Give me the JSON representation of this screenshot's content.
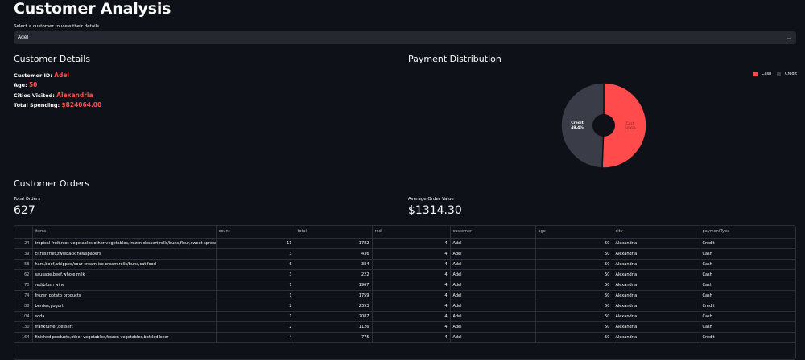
{
  "title": "Customer Analysis",
  "select": {
    "label": "Select a customer to view their details",
    "value": "Adel"
  },
  "details": {
    "heading": "Customer Details",
    "id_label": "Customer ID:",
    "id_value": "Adel",
    "age_label": "Age:",
    "age_value": "50",
    "cities_label": "Cities Visited:",
    "cities_value": "Alexandria",
    "spending_label": "Total Spending:",
    "spending_value": "$824064.00"
  },
  "payment": {
    "heading": "Payment Distribution",
    "legend": [
      "Cash",
      "Credit"
    ],
    "colors": {
      "cash": "#ff4b4b",
      "credit": "#3a3d47"
    }
  },
  "chart_data": {
    "type": "pie",
    "labels": [
      "Cash",
      "Credit"
    ],
    "values": [
      50.6,
      49.4
    ],
    "slice_labels": [
      "Cash\n50.6%",
      "Credit\n49.4%"
    ],
    "legend": "top-right"
  },
  "orders": {
    "heading": "Customer Orders",
    "total_label": "Total Orders",
    "total_value": "627",
    "avg_label": "Average Order Value",
    "avg_value": "$1314.30",
    "columns": [
      "",
      "items",
      "count",
      "total",
      "rnd",
      "customer",
      "age",
      "city",
      "paymentType"
    ],
    "rows": [
      [
        "24",
        "tropical fruit,root vegetables,other vegetables,frozen dessert,rolls/buns,flour,sweet spreads,sa",
        "11",
        "1782",
        "4",
        "Adel",
        "50",
        "Alexandria",
        "Credit"
      ],
      [
        "39",
        "citrus fruit,zwieback,newspapers",
        "3",
        "436",
        "4",
        "Adel",
        "50",
        "Alexandria",
        "Cash"
      ],
      [
        "58",
        "ham,beef,whipped/sour cream,ice cream,rolls/buns,cat food",
        "6",
        "384",
        "4",
        "Adel",
        "50",
        "Alexandria",
        "Cash"
      ],
      [
        "62",
        "sausage,beef,whole milk",
        "3",
        "222",
        "4",
        "Adel",
        "50",
        "Alexandria",
        "Cash"
      ],
      [
        "70",
        "red/blush wine",
        "1",
        "1967",
        "4",
        "Adel",
        "50",
        "Alexandria",
        "Cash"
      ],
      [
        "74",
        "frozen potato products",
        "1",
        "1759",
        "4",
        "Adel",
        "50",
        "Alexandria",
        "Cash"
      ],
      [
        "88",
        "berries,yogurt",
        "2",
        "2353",
        "4",
        "Adel",
        "50",
        "Alexandria",
        "Credit"
      ],
      [
        "104",
        "soda",
        "1",
        "2087",
        "4",
        "Adel",
        "50",
        "Alexandria",
        "Cash"
      ],
      [
        "130",
        "frankfurter,dessert",
        "2",
        "1126",
        "4",
        "Adel",
        "50",
        "Alexandria",
        "Cash"
      ],
      [
        "164",
        "finished products,other vegetables,frozen vegetables,bottled beer",
        "4",
        "775",
        "4",
        "Adel",
        "50",
        "Alexandria",
        "Credit"
      ]
    ]
  }
}
